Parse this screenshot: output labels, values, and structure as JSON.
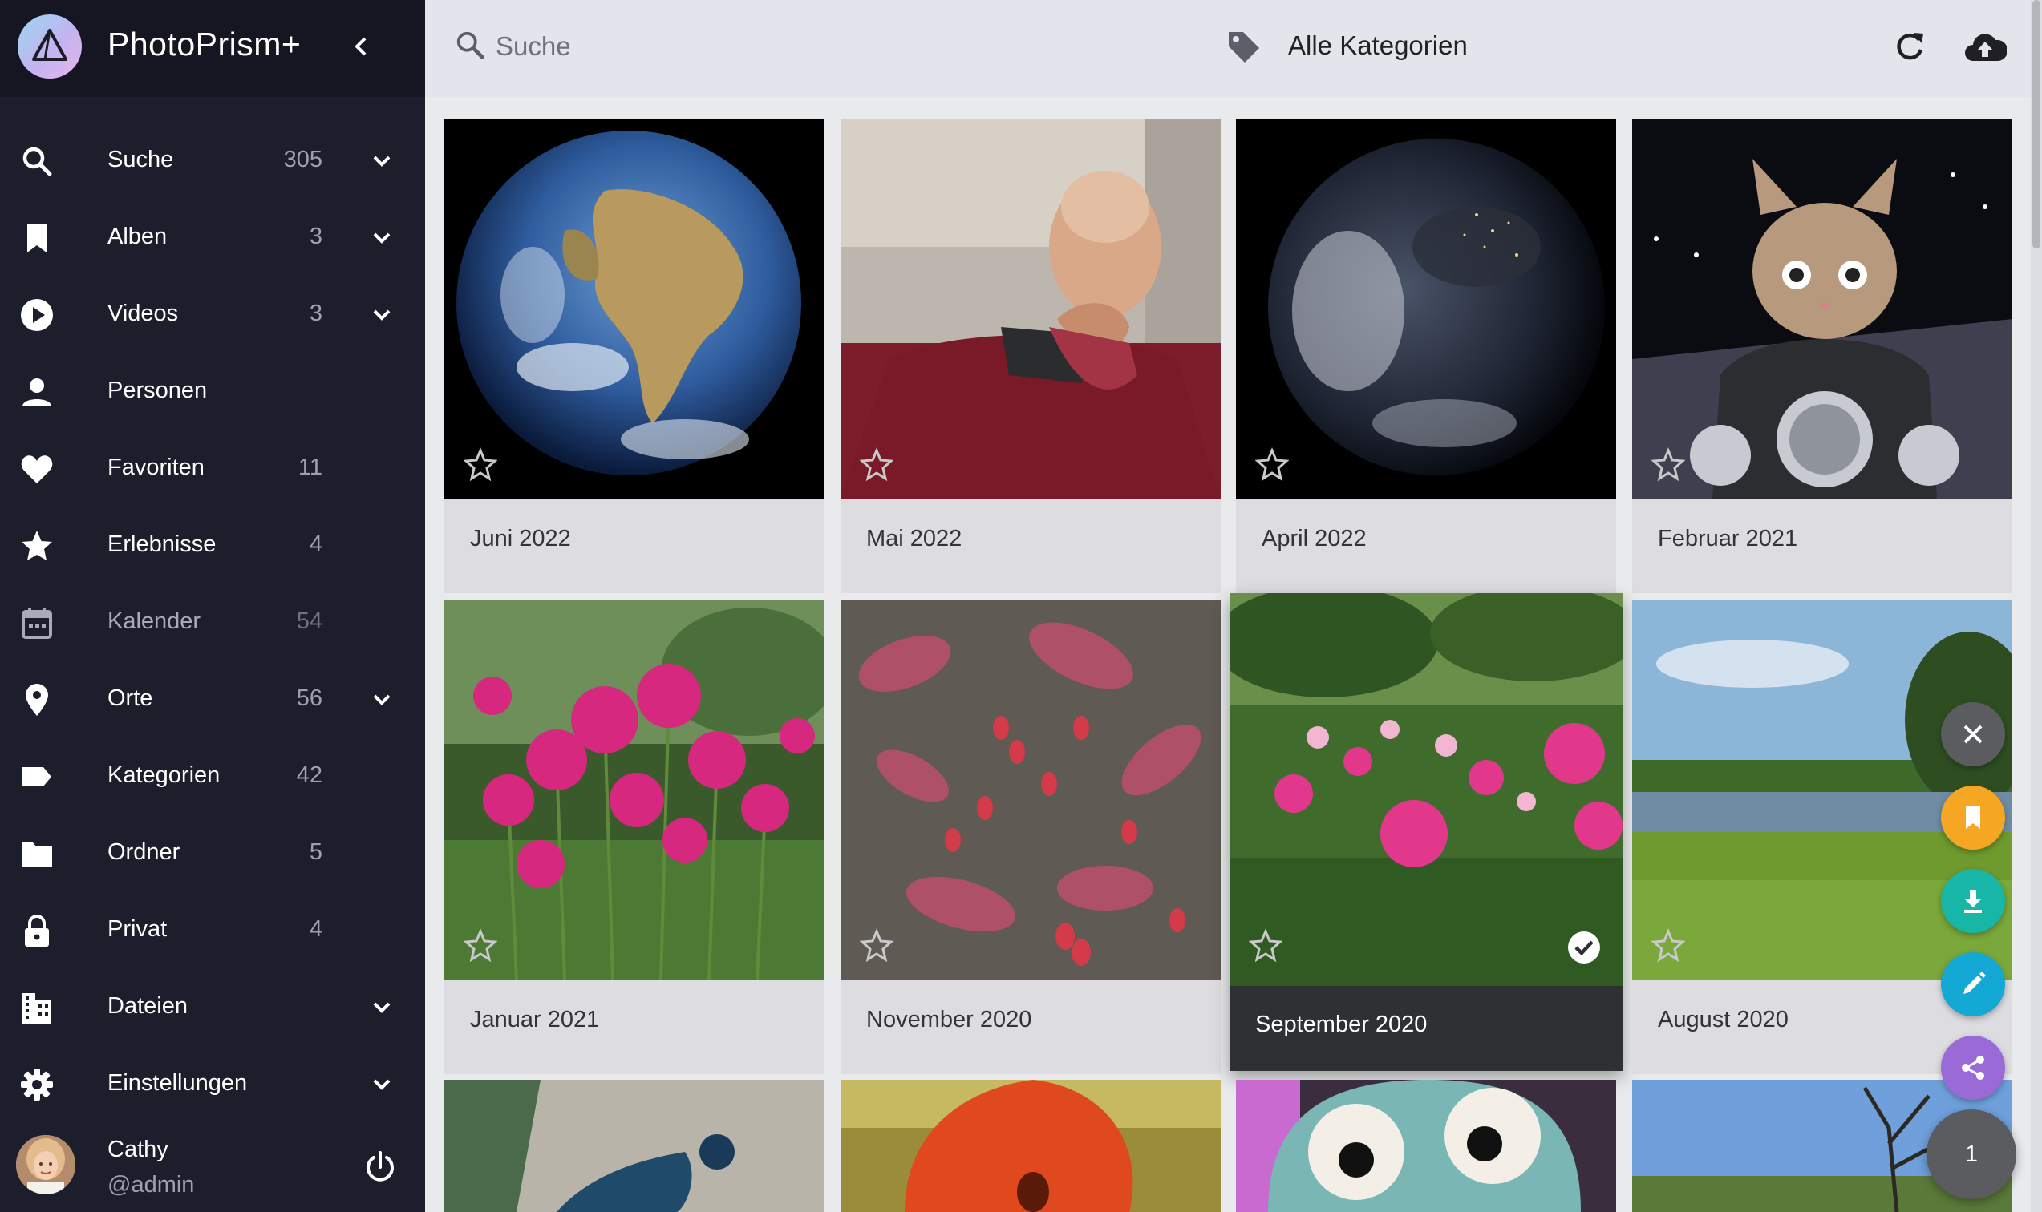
{
  "app": {
    "title": "PhotoPrism+"
  },
  "sidebar": {
    "items": [
      {
        "label": "Suche",
        "count": "305",
        "icon": "search-icon"
      },
      {
        "label": "Alben",
        "count": "3",
        "icon": "bookmark-icon"
      },
      {
        "label": "Videos",
        "count": "3",
        "icon": "play-circle-icon"
      },
      {
        "label": "Personen",
        "count": "",
        "icon": "person-icon"
      },
      {
        "label": "Favoriten",
        "count": "11",
        "icon": "heart-icon"
      },
      {
        "label": "Erlebnisse",
        "count": "4",
        "icon": "star-icon"
      },
      {
        "label": "Kalender",
        "count": "54",
        "icon": "calendar-icon"
      },
      {
        "label": "Orte",
        "count": "56",
        "icon": "map-pin-icon"
      },
      {
        "label": "Kategorien",
        "count": "42",
        "icon": "label-icon"
      },
      {
        "label": "Ordner",
        "count": "5",
        "icon": "folder-icon"
      },
      {
        "label": "Privat",
        "count": "4",
        "icon": "lock-icon"
      },
      {
        "label": "Dateien",
        "count": "",
        "icon": "files-icon"
      },
      {
        "label": "Einstellungen",
        "count": "",
        "icon": "gear-icon"
      }
    ],
    "user": {
      "name": "Cathy",
      "handle": "@admin"
    }
  },
  "toolbar": {
    "search_placeholder": "Suche",
    "category": "Alle Kategorien"
  },
  "grid": {
    "cards": [
      {
        "caption": "Juni 2022",
        "image": "earth-day"
      },
      {
        "caption": "Mai 2022",
        "image": "facepalm-man"
      },
      {
        "caption": "April 2022",
        "image": "earth-night"
      },
      {
        "caption": "Februar 2021",
        "image": "cat-motorcycle"
      },
      {
        "caption": "Januar 2021",
        "image": "pink-flowers"
      },
      {
        "caption": "November 2020",
        "image": "red-berries"
      },
      {
        "caption": "September 2020",
        "image": "dahlia-garden",
        "selected": true
      },
      {
        "caption": "August 2020",
        "image": "pond-landscape"
      },
      {
        "caption": "",
        "image": "peacock"
      },
      {
        "caption": "",
        "image": "poppy"
      },
      {
        "caption": "",
        "image": "plush-toy"
      },
      {
        "caption": "",
        "image": "tree-sky"
      }
    ]
  },
  "fab": {
    "selection_count": "1"
  },
  "colors": {
    "sidebar_bg": "#1d1e2c",
    "toolbar_bg": "#e3e5ec",
    "fab_close": "#5b5c60",
    "fab_album": "#f5a623",
    "fab_download": "#17b6a6",
    "fab_edit": "#14a8d4",
    "fab_share": "#9a6ad6"
  }
}
